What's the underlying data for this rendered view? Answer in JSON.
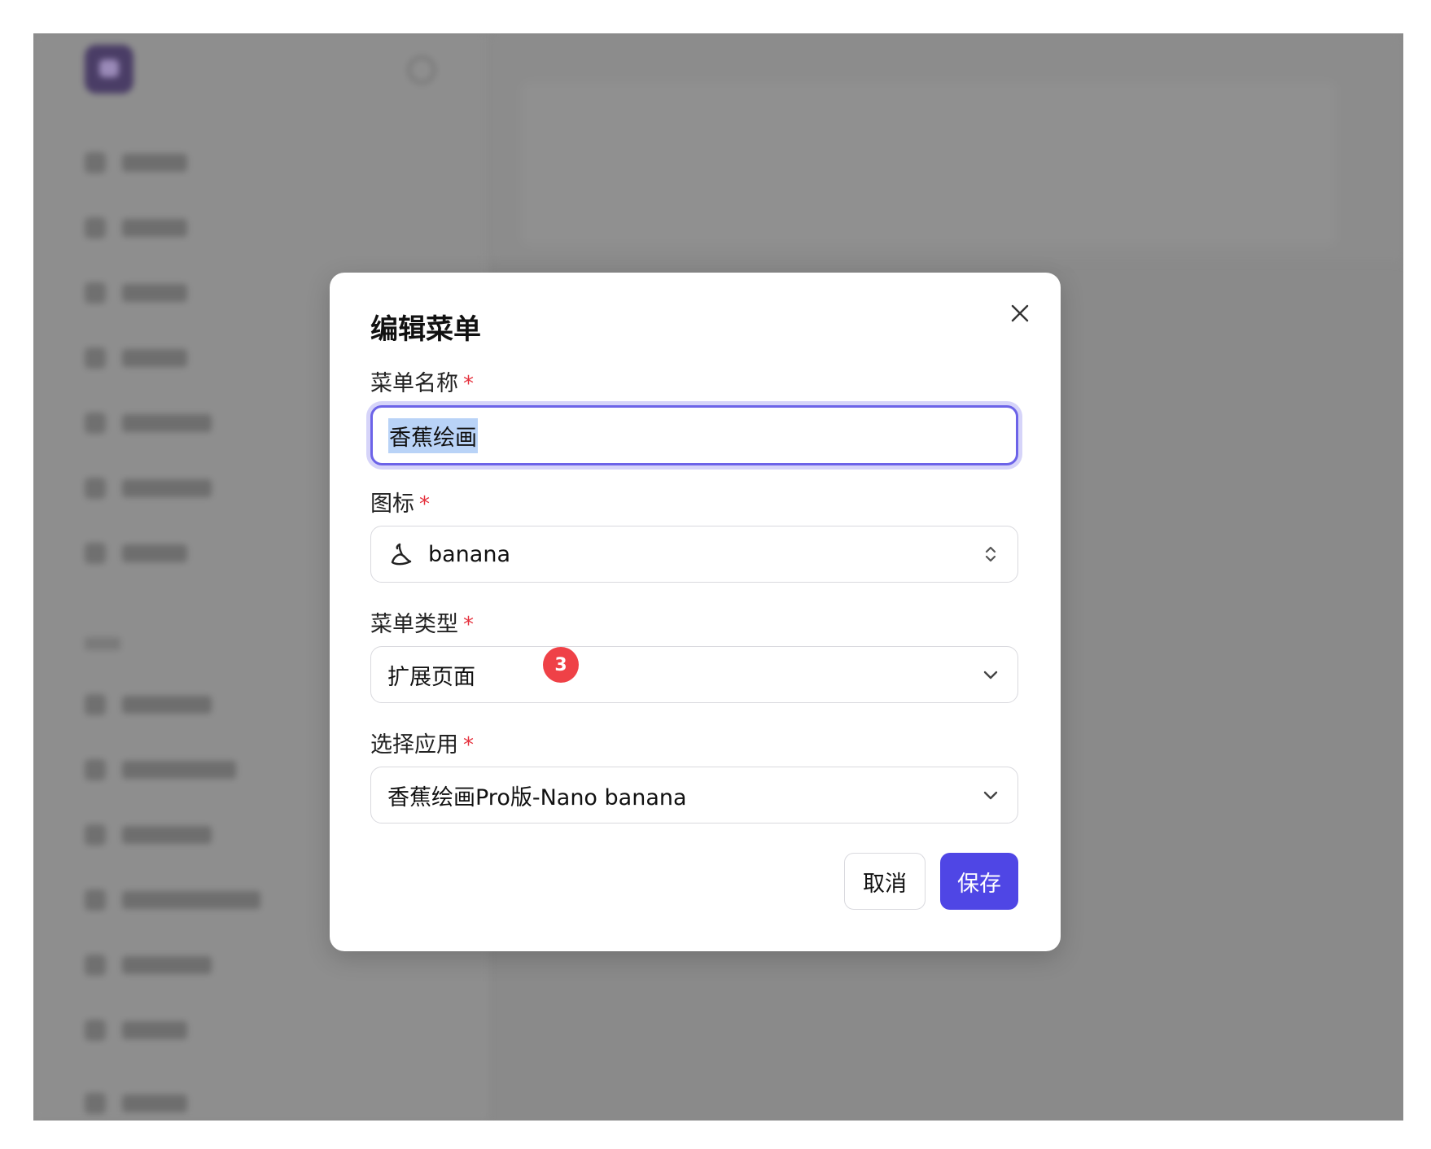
{
  "modal": {
    "title": "编辑菜单",
    "required_mark": "*",
    "fields": {
      "name": {
        "label": "菜单名称",
        "value": "香蕉绘画"
      },
      "icon": {
        "label": "图标",
        "value": "banana",
        "icon": "banana-icon"
      },
      "type": {
        "label": "菜单类型",
        "value": "扩展页面"
      },
      "app": {
        "label": "选择应用",
        "value": "香蕉绘画Pro版-Nano banana"
      }
    },
    "badge": "3",
    "buttons": {
      "cancel": "取消",
      "save": "保存"
    }
  },
  "colors": {
    "accent": "#4f46e5",
    "focus_ring": "#6c63e8",
    "required": "#e5323e",
    "badge": "#ef4147",
    "overlay": "#8a8a8a"
  }
}
